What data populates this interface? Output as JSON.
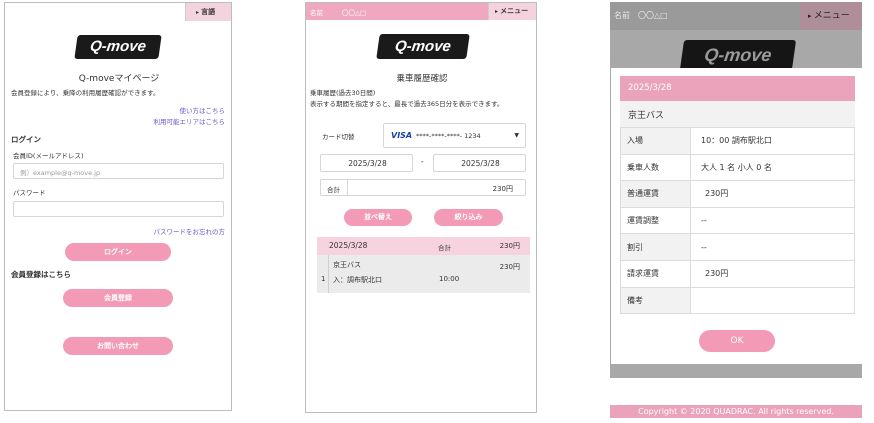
{
  "screen1": {
    "lang_label": "言語",
    "logo": "Q-move",
    "title": "Q-moveマイページ",
    "intro": "会員登録により、乗降の利用履歴確認ができます。",
    "link_usage": "使い方はこちら",
    "link_area": "利用可能エリアはこちら",
    "login_heading": "ログイン",
    "member_id_label": "会員ID(メールアドレス)",
    "member_id_placeholder": "例）example@q-move.jp",
    "password_label": "パスワード",
    "password_value": "",
    "forgot_link": "パスワードをお忘れの方",
    "login_button": "ログイン",
    "register_heading": "会員登録はこちら",
    "register_button": "会員登録",
    "contact_button": "お問い合わせ"
  },
  "screen2": {
    "name_label": "名前",
    "name_value": "〇〇△□",
    "menu_label": "メニュー",
    "logo": "Q-move",
    "title": "乗車履歴確認",
    "desc1": "乗車履歴(過去30日間)",
    "desc2": "表示する期間を指定すると、最長で過去365日分を表示できます。",
    "card_label": "カード切替",
    "card_brand": "VISA",
    "card_number": "****-****-****- 1234",
    "date_from": "2025/3/28",
    "date_sep": "-",
    "date_to": "2025/3/28",
    "total_label": "合計",
    "total_value": "230円",
    "sort_button": "並べ替え",
    "filter_button": "絞り込み",
    "result": {
      "date": "2025/3/28",
      "sum_label": "合計",
      "sum_value": "230円",
      "company": "京王バス",
      "fare": "230円",
      "index": "1",
      "board": "入：調布駅北口",
      "time": "10:00"
    }
  },
  "screen3": {
    "name_label": "名前",
    "name_value": "〇〇△□",
    "menu_label": "メニュー",
    "logo": "Q-move",
    "modal_date": "2025/3/28",
    "company": "京王バス",
    "rows": [
      {
        "key": "入場",
        "value": "10：00 調布駅北口"
      },
      {
        "key": "乗車人数",
        "value": "大人 1 名  小人 0 名"
      },
      {
        "key": "普通運賃",
        "value": "230円"
      },
      {
        "key": "運賃調整",
        "value": "--"
      },
      {
        "key": "割引",
        "value": "--"
      },
      {
        "key": "請求運賃",
        "value": "230円"
      },
      {
        "key": "備考",
        "value": ""
      }
    ],
    "ok_button": "OK",
    "footer": "Copyright © 2020 QUADRAC. All rights reserved."
  },
  "colors": {
    "accent_pink": "#f29ab6",
    "light_pink": "#f6d3df",
    "header_pink": "#eba2bb",
    "link": "#6a5acd"
  }
}
